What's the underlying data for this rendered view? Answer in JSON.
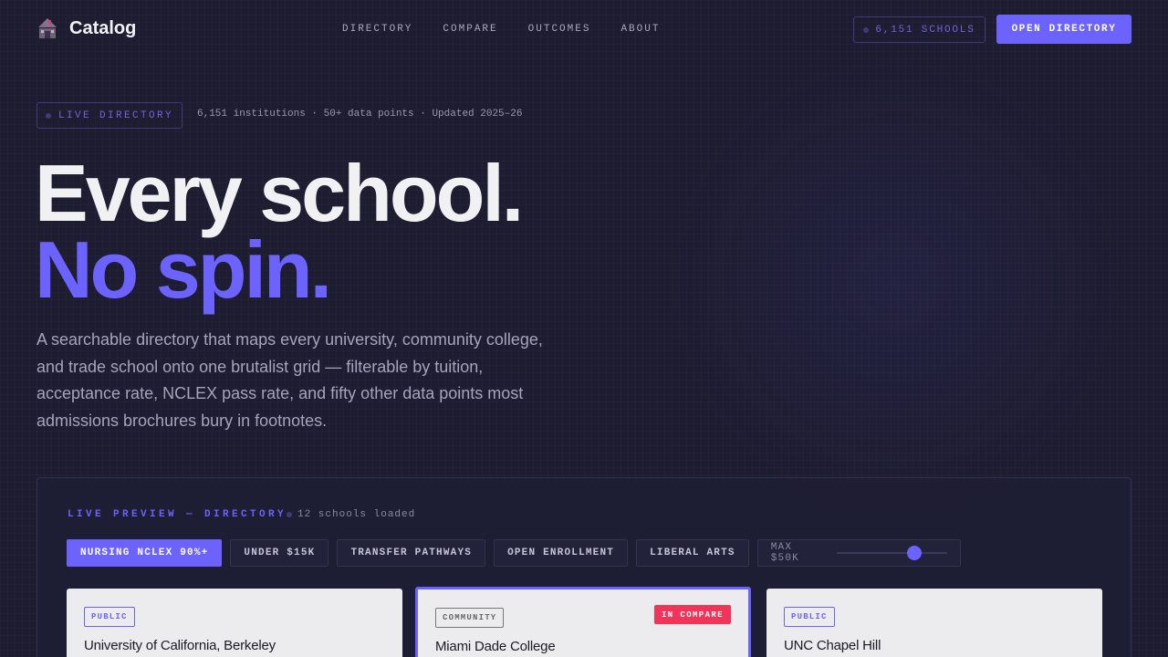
{
  "header": {
    "logo_text": "Catalog",
    "nav": [
      "DIRECTORY",
      "COMPARE",
      "OUTCOMES",
      "ABOUT"
    ],
    "schools_count": "6,151 SCHOOLS",
    "cta": "OPEN DIRECTORY"
  },
  "hero": {
    "badge": "LIVE DIRECTORY",
    "meta": "6,151 institutions · 50+ data points · Updated 2025–26",
    "title_line1": "Every school.",
    "title_line2": "No spin.",
    "lede": "A searchable directory that maps every university, community college, and trade school onto one brutalist grid — filterable by tuition, acceptance rate, NCLEX pass rate, and fifty other data points most admissions brochures bury in footnotes."
  },
  "preview": {
    "title": "LIVE PREVIEW — DIRECTORY",
    "loaded": "12 schools loaded",
    "filters": [
      "NURSING NCLEX 90%+",
      "UNDER $15K",
      "TRANSFER PATHWAYS",
      "OPEN ENROLLMENT",
      "LIBERAL ARTS"
    ],
    "slider_label": "MAX $50K",
    "slider_value_fraction": 0.68,
    "cards": [
      {
        "tag": "PUBLIC",
        "name": "University of California, Berkeley",
        "badge": ""
      },
      {
        "tag": "COMMUNITY",
        "name": "Miami Dade College",
        "badge": "IN COMPARE"
      },
      {
        "tag": "PUBLIC",
        "name": "UNC Chapel Hill",
        "badge": ""
      }
    ]
  },
  "colors": {
    "accent": "#6c63ff",
    "background": "#1d1c30",
    "compare_badge": "#f0345a"
  }
}
